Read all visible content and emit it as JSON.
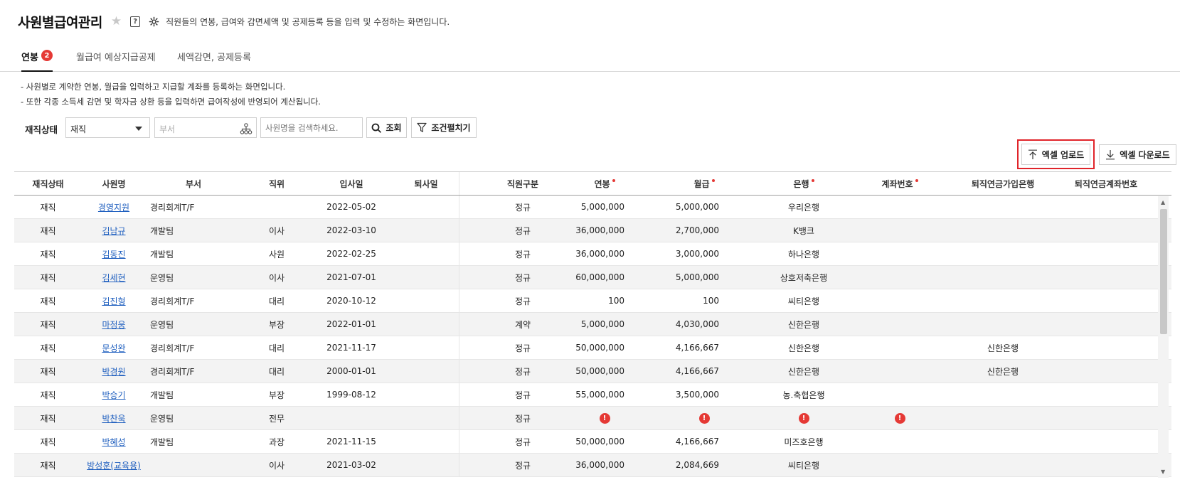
{
  "header": {
    "title": "사원별급여관리",
    "description": "직원들의 연봉, 급여와 감면세액 및 공제등록 등을 입력 및 수정하는 화면입니다."
  },
  "tabs": [
    {
      "label": "연봉",
      "badge": "2"
    },
    {
      "label": "월급여 예상지급공제"
    },
    {
      "label": "세액감면, 공제등록"
    }
  ],
  "notes": [
    "- 사원별로 계약한 연봉, 월급을 입력하고 지급할 계좌를 등록하는 화면입니다.",
    "- 또한 각종 소득세 감면 및 학자금 상환 등을 입력하면 급여작성에 반영되어 계산됩니다."
  ],
  "filter": {
    "status_label": "재직상태",
    "status_value": "재직",
    "dept_placeholder": "부서",
    "name_placeholder": "사원명을 검색하세요.",
    "search_label": "조회",
    "filter_label": "조건펼치기"
  },
  "actions": {
    "upload_label": "엑셀 업로드",
    "download_label": "엑셀 다운로드"
  },
  "table": {
    "columns": [
      "재직상태",
      "사원명",
      "부서",
      "직위",
      "입사일",
      "퇴사일",
      "직원구분",
      "연봉",
      "월급",
      "은행",
      "계좌번호",
      "퇴직연금가입은행",
      "퇴직연금계좌번호"
    ],
    "rows": [
      {
        "status": "재직",
        "name": "경영지원",
        "dept": "경리회계T/F",
        "position": "",
        "join": "2022-05-02",
        "leave": "",
        "type": "정규",
        "salary": "5,000,000",
        "monthly": "5,000,000",
        "bank": "우리은행",
        "account": "",
        "pension_bank": "",
        "pension_account": ""
      },
      {
        "status": "재직",
        "name": "김남규",
        "dept": "개발팀",
        "position": "이사",
        "join": "2022-03-10",
        "leave": "",
        "type": "정규",
        "salary": "36,000,000",
        "monthly": "2,700,000",
        "bank": "K뱅크",
        "account": "",
        "pension_bank": "",
        "pension_account": ""
      },
      {
        "status": "재직",
        "name": "김동진",
        "dept": "개발팀",
        "position": "사원",
        "join": "2022-02-25",
        "leave": "",
        "type": "정규",
        "salary": "36,000,000",
        "monthly": "3,000,000",
        "bank": "하나은행",
        "account": "",
        "pension_bank": "",
        "pension_account": ""
      },
      {
        "status": "재직",
        "name": "김세현",
        "dept": "운영팀",
        "position": "이사",
        "join": "2021-07-01",
        "leave": "",
        "type": "정규",
        "salary": "60,000,000",
        "monthly": "5,000,000",
        "bank": "상호저축은행",
        "account": "",
        "pension_bank": "",
        "pension_account": ""
      },
      {
        "status": "재직",
        "name": "김진형",
        "dept": "경리회계T/F",
        "position": "대리",
        "join": "2020-10-12",
        "leave": "",
        "type": "정규",
        "salary": "100",
        "monthly": "100",
        "bank": "씨티은행",
        "account": "",
        "pension_bank": "",
        "pension_account": ""
      },
      {
        "status": "재직",
        "name": "마정웅",
        "dept": "운영팀",
        "position": "부장",
        "join": "2022-01-01",
        "leave": "",
        "type": "계약",
        "salary": "5,000,000",
        "monthly": "4,030,000",
        "bank": "신한은행",
        "account": "",
        "pension_bank": "",
        "pension_account": ""
      },
      {
        "status": "재직",
        "name": "문성완",
        "dept": "경리회계T/F",
        "position": "대리",
        "join": "2021-11-17",
        "leave": "",
        "type": "정규",
        "salary": "50,000,000",
        "monthly": "4,166,667",
        "bank": "신한은행",
        "account": "",
        "pension_bank": "신한은행",
        "pension_account": ""
      },
      {
        "status": "재직",
        "name": "박경원",
        "dept": "경리회계T/F",
        "position": "대리",
        "join": "2000-01-01",
        "leave": "",
        "type": "정규",
        "salary": "50,000,000",
        "monthly": "4,166,667",
        "bank": "신한은행",
        "account": "",
        "pension_bank": "신한은행",
        "pension_account": ""
      },
      {
        "status": "재직",
        "name": "박승기",
        "dept": "개발팀",
        "position": "부장",
        "join": "1999-08-12",
        "leave": "",
        "type": "정규",
        "salary": "55,000,000",
        "monthly": "3,500,000",
        "bank": "농.축협은행",
        "account": "",
        "pension_bank": "",
        "pension_account": ""
      },
      {
        "status": "재직",
        "name": "박찬욱",
        "dept": "운영팀",
        "position": "전무",
        "join": "",
        "leave": "",
        "type": "정규",
        "salary": "!",
        "monthly": "!",
        "bank": "!",
        "account": "!",
        "pension_bank": "",
        "pension_account": "",
        "missing": true
      },
      {
        "status": "재직",
        "name": "박혜성",
        "dept": "개발팀",
        "position": "과장",
        "join": "2021-11-15",
        "leave": "",
        "type": "정규",
        "salary": "50,000,000",
        "monthly": "4,166,667",
        "bank": "미즈호은행",
        "account": "",
        "pension_bank": "",
        "pension_account": ""
      },
      {
        "status": "재직",
        "name": "방성훈(교육용)",
        "dept": "",
        "position": "이사",
        "join": "2021-03-02",
        "leave": "",
        "type": "정규",
        "salary": "36,000,000",
        "monthly": "2,084,669",
        "bank": "씨티은행",
        "account": "",
        "pension_bank": "",
        "pension_account": ""
      }
    ]
  },
  "colors": {
    "accent_red": "#e53935",
    "link": "#1f5fbf",
    "highlight_border": "#e0242a"
  }
}
